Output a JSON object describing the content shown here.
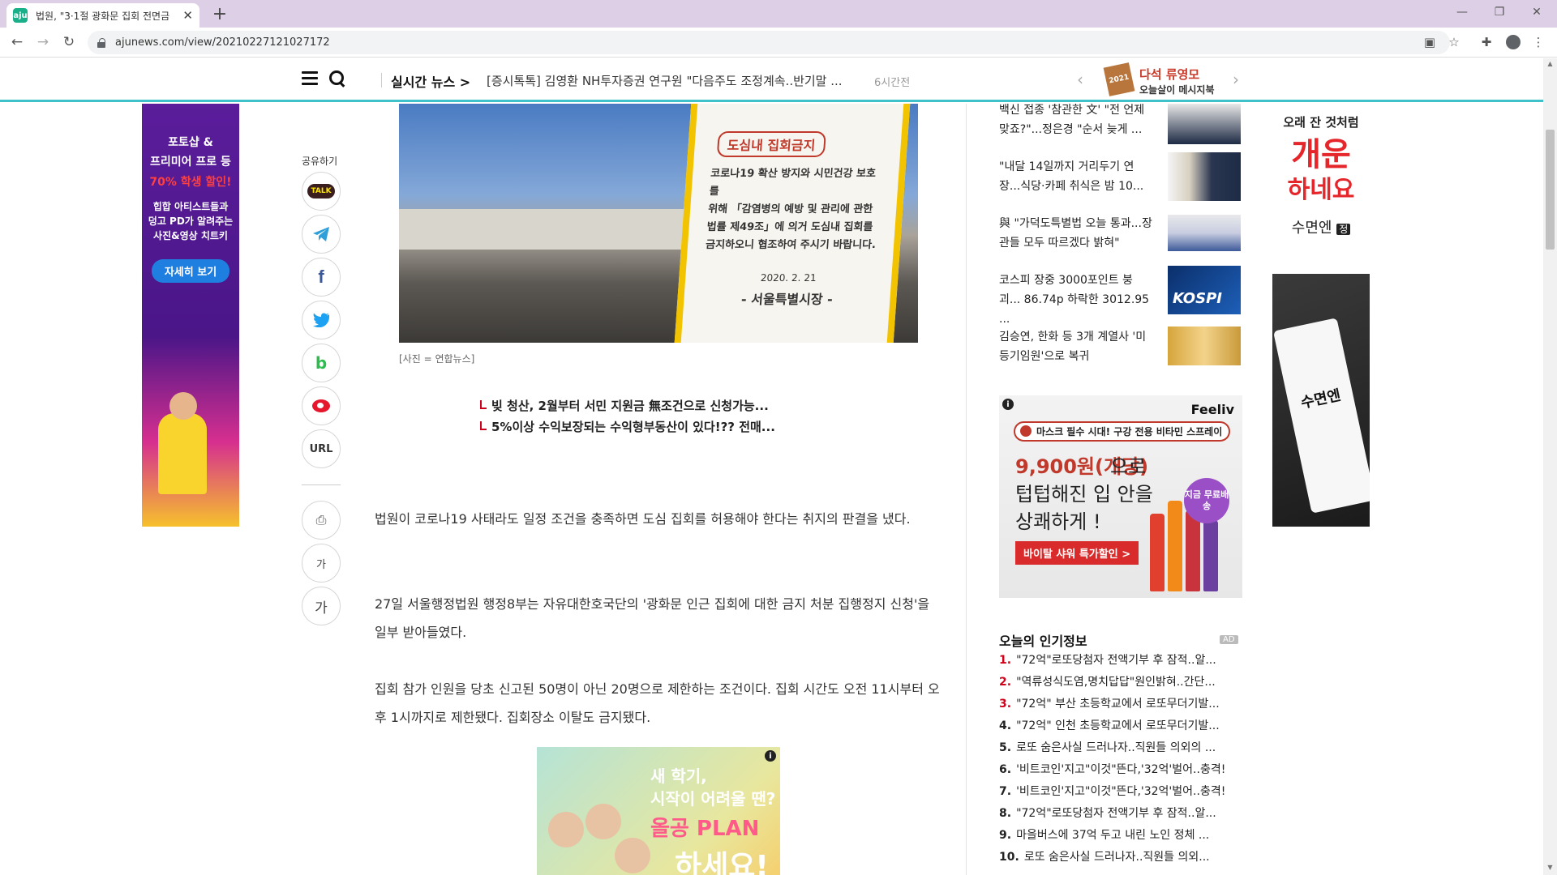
{
  "browser": {
    "tab_title": "법원, \"3·1절 광화문 집회 전면금",
    "tab_favicon": "aju",
    "new_tab": "+",
    "url": "ajunews.com/view/20210227121027172"
  },
  "header": {
    "realtime_label": "실시간 뉴스 >",
    "realtime_headline": "[증시톡톡] 김영환 NH투자증권 연구원 \"다음주도 조정계속..반기말 ...",
    "realtime_time": "6시간전",
    "promo_badge": "2021",
    "promo_title": "다석 류영모",
    "promo_subtitle": "오늘살이 메시지북"
  },
  "left_ad": {
    "line1": "포토샵 &",
    "line2": "프리미어 프로 등",
    "line3": "70% 학생 할인!",
    "line4": "힙합 아티스트들과",
    "line5": "덩고 PD가 알려주는",
    "line6": "사진&영상 치트키",
    "button": "자세히 보기"
  },
  "share": {
    "label": "공유하기",
    "talk": "TALK",
    "facebook": "f",
    "url": "URL",
    "font_small": "가",
    "font_large": "가"
  },
  "photo": {
    "sign_title": "도심내 집회금지",
    "sign_body_1": "코로나19 확산 방지와 시민건강 보호를",
    "sign_body_2": "위해 「감염병의 예방 및 관리에 관한",
    "sign_body_3": "법률 제49조」에 의거 도심내 집회를",
    "sign_body_4": "금지하오니 협조하여 주시기 바랍니다.",
    "sign_date": "2020. 2. 21",
    "sign_author": "- 서울특별시장 -",
    "caption": "[사진 = 연합뉴스]"
  },
  "related": [
    "빚 청산, 2월부터 서민 지원금 無조건으로 신청가능...",
    "5%이상 수익보장되는 수익형부동산이 있다!?? 전매..."
  ],
  "article": {
    "p1": "법원이 코로나19 사태라도 일정 조건을 충족하면 도심 집회를 허용해야 한다는 취지의 판결을 냈다.",
    "p2": "27일 서울행정법원 행정8부는 자유대한호국단의 '광화문 인근 집회에 대한 금지 처분 집행정지 신청'을 일부 받아들였다.",
    "p3": "집회 참가 인원을 당초 신고된 50명이 아닌 20명으로 제한하는 조건이다. 집회 시간도 오전 11시부터 오후 1시까지로 제한됐다. 집회장소 이탈도 금지됐다."
  },
  "article_ad": {
    "line1": "새 학기,",
    "line2": "시작이 어려울 땐?",
    "line3": "올공 PLAN",
    "line4": "하세요!",
    "info": "i"
  },
  "right_news": [
    {
      "title": "백신 접종 '참관한 文' \"전 언제 맞죠?\"...정은경 \"순서 늦게 ...",
      "thumb": "president"
    },
    {
      "title": "\"내달 14일까지 거리두기 연장...식당·카페 취식은 밤 10...",
      "thumb": "briefing"
    },
    {
      "title": "與 \"가덕도특별법 오늘 통과...장관들 모두 따르겠다 밝혀\"",
      "thumb": "meeting"
    },
    {
      "title": "코스피 장중 3000포인트 붕괴... 86.74p 하락한 3012.95 ...",
      "thumb": "KOSPI"
    },
    {
      "title": "김승연, 한화 등 3개 계열사 '미등기임원'으로 복귀",
      "thumb": "portrait"
    }
  ],
  "side_ad": {
    "brand": "Feeliv",
    "pill": "마스크 필수 시대! 구강 전용 비타민 스프레이",
    "price": "9,900원(개당)",
    "price_suffix": "으로",
    "line2": "텁텁해진 입 안을",
    "line3": "상쾌하게 !",
    "cta": "바이탈 샤워 특가할인 >",
    "badge": "지금 무료배송",
    "info": "i"
  },
  "popular": {
    "title": "오늘의 인기정보",
    "ad": "AD",
    "items": [
      {
        "num": "1.",
        "text": "\"72억\"로또당첨자 전액기부 후 잠적..알...",
        "highlight": true
      },
      {
        "num": "2.",
        "text": "\"역류성식도염,명치답답\"원인밝혀..간단...",
        "highlight": true
      },
      {
        "num": "3.",
        "text": "\"72억\" 부산 초등학교에서 로또무더기발...",
        "highlight": true
      },
      {
        "num": "4.",
        "text": "\"72억\" 인천 초등학교에서 로또무더기발...",
        "highlight": false
      },
      {
        "num": "5.",
        "text": "로또 숨은사실 드러나자..직원들 의외의 ...",
        "highlight": false
      },
      {
        "num": "6.",
        "text": "'비트코인'지고\"이것\"뜬다,'32억'벌어..충격!",
        "highlight": false
      },
      {
        "num": "7.",
        "text": "'비트코인'지고\"이것\"뜬다,'32억'벌어..충격!",
        "highlight": false
      },
      {
        "num": "8.",
        "text": "\"72억\"로또당첨자 전액기부 후 잠적..알...",
        "highlight": false
      },
      {
        "num": "9.",
        "text": "마을버스에 37억 두고 내린 노인 정체 ...",
        "highlight": false
      },
      {
        "num": "10.",
        "text": "로또 숨은사실 드러나자..직원들 의외...",
        "highlight": false
      }
    ]
  },
  "right_ad": {
    "line1": "오래 잔 것처럼",
    "line2": "개운",
    "line3": "하네요",
    "line4": "수면엔",
    "badge": "정",
    "pack": "수면엔"
  },
  "colors": {
    "accent": "#3fc1c9",
    "headline_red": "#d0021b",
    "tab_bg": "#ddd0e6"
  }
}
